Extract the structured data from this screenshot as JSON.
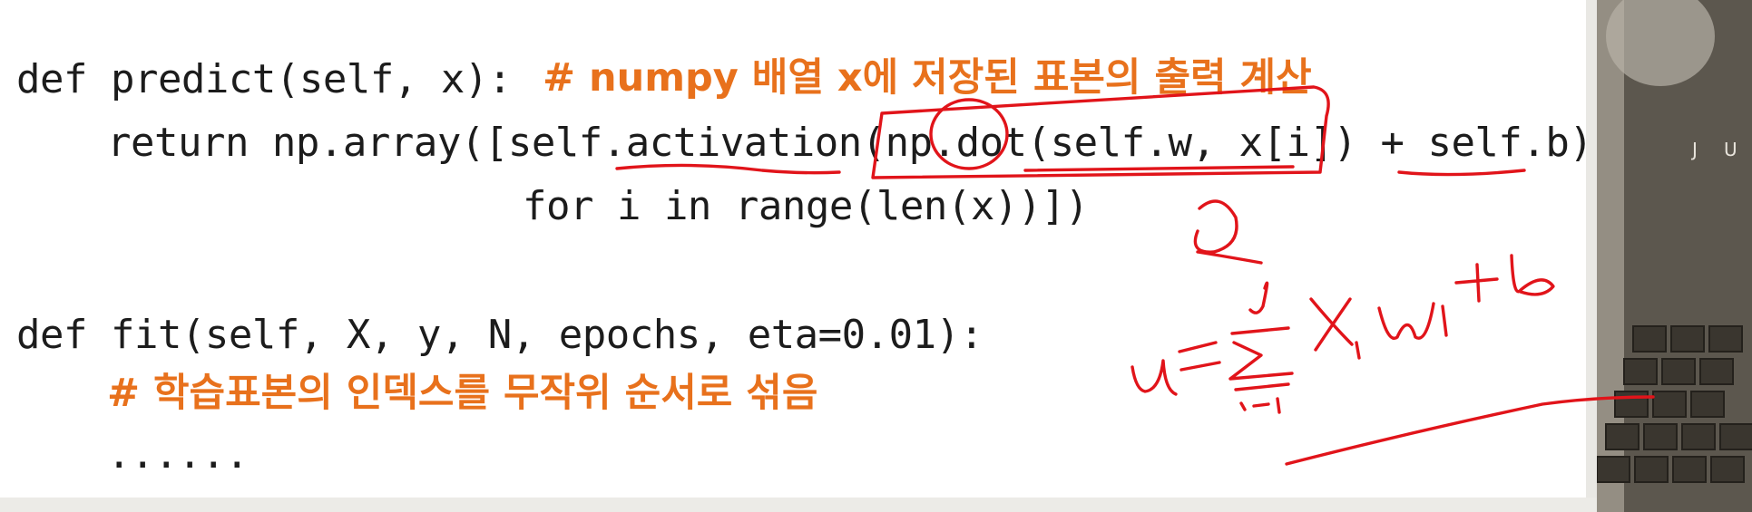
{
  "code": {
    "predict_def": "def predict(self, x):",
    "predict_comment": "# numpy 배열 x에 저장된 표본의 출력 계산",
    "return_line": "return np.array([self.activation(np.dot(self.w, x[i]) + self.b)",
    "for_line": "for i in range(len(x))])",
    "fit_def": "def fit(self, X, y, N, epochs, eta=0.01):",
    "fit_comment": "# 학습표본의 인덱스를 무작위 순서로 섞음",
    "ellipsis": "......"
  },
  "colors": {
    "code_text": "#1c1c1c",
    "comment_text": "#e8711c",
    "annotation_ink": "#e1141a",
    "slide_background": "#ffffff"
  },
  "handwritten_annotation": {
    "description": "red pen formula u = sum_{i=1}^{d} x_i w_i + b with underline, a circled symbol, underlines under activation, dot and self.b"
  }
}
